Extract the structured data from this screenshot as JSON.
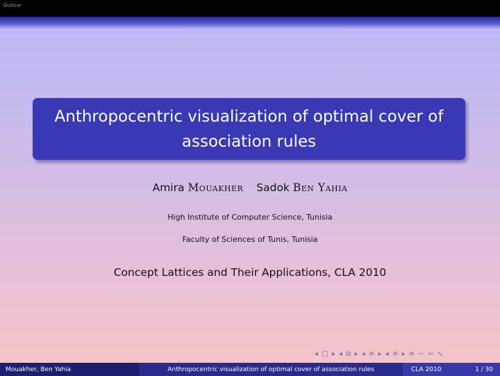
{
  "header": {
    "outline_label": "Outline"
  },
  "title": {
    "line1": "Anthropocentric visualization of optimal cover of",
    "line2": "association rules"
  },
  "authors": [
    {
      "first": "Amira",
      "last": "Mouakher"
    },
    {
      "first": "Sadok",
      "last": "Ben Yahia"
    }
  ],
  "institutions": [
    "High Institute of Computer Science, Tunisia",
    "Faculty of Sciences of Tunis, Tunisia"
  ],
  "conference": "Concept Lattices and Their Applications, CLA 2010",
  "navigation": {
    "symbols": "◂ □ ▸ ◂ ⧉ ▸ ◂ ≡ ▸ ◂ ≡ ▸ ≡ ∽ ∾ ∿"
  },
  "footer": {
    "authors": "Mouakher, Ben Yahia",
    "title": "Anthropocentric visualization of optimal cover of association rules",
    "conference": "CLA 2010",
    "page": "1 / 30"
  }
}
